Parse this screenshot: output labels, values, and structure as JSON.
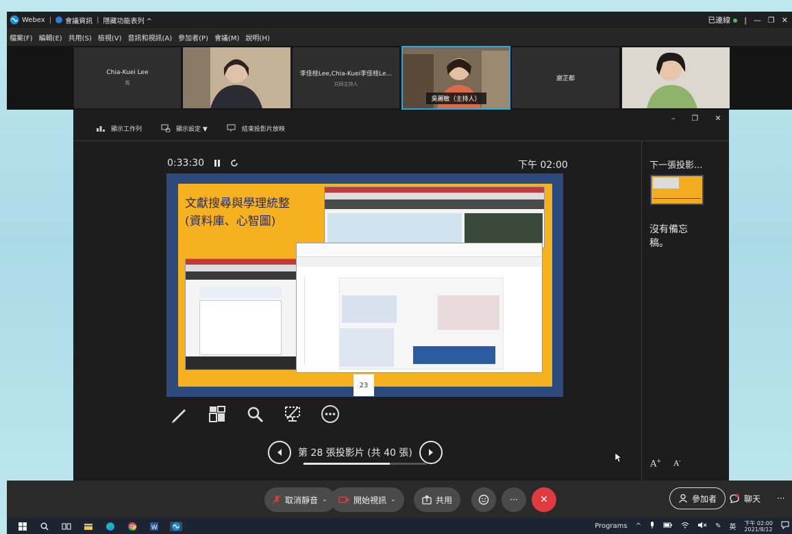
{
  "window": {
    "app_name": "Webex",
    "meeting_info": "會議資訊",
    "hide_controls": "隱藏功能表列 ^",
    "connection_status": "已連線",
    "win_min": "—",
    "win_restore": "❐",
    "win_close": "✕"
  },
  "menu": [
    "檔案(F)",
    "編輯(E)",
    "共用(S)",
    "檢視(V)",
    "音訊和視訊(A)",
    "參加者(P)",
    "會議(M)",
    "說明(H)"
  ],
  "videos": [
    {
      "name": "Chia-Kuei Lee",
      "sub": "我"
    },
    {
      "name": "",
      "sub": ""
    },
    {
      "name": "李佳桂Lee,Chia-Kuei李佳桂Le...",
      "sub": "共同主持人"
    },
    {
      "name": "吳麗敏（主持人）",
      "sub": ""
    },
    {
      "name": "謝芷都",
      "sub": ""
    },
    {
      "name": "",
      "sub": ""
    }
  ],
  "presenter": {
    "toolbar": {
      "show_taskbar": "顯示工作列",
      "display_settings": "顯示設定 ▼",
      "end_show": "結束投影片放映"
    },
    "elapsed": "0:33:30",
    "clock": "下午 02:00",
    "next_label": "下一張投影...",
    "notes": "沒有備忘稿。",
    "font_up": "A",
    "font_down": "A",
    "slide_title_line1": "文獻搜尋與學理統整",
    "slide_title_line2": "(資料庫、心智圖)",
    "slide_page": "23",
    "slide_counter": "第 28 張投影片 (共 40 張)",
    "progress": 0.7
  },
  "controls": {
    "unmute": "取消靜音",
    "start_video": "開始視訊",
    "share": "共用",
    "participants": "參加者",
    "chat": "聊天"
  },
  "taskbar": {
    "programs": "Programs",
    "ime": "英",
    "time": "下午 02:00",
    "date": "2021/8/12"
  },
  "colors": {
    "slide_bg": "#f6b21e",
    "slide_frame": "#2d4a7c",
    "end_call": "#e0393e",
    "active_border": "#27a8e0"
  }
}
